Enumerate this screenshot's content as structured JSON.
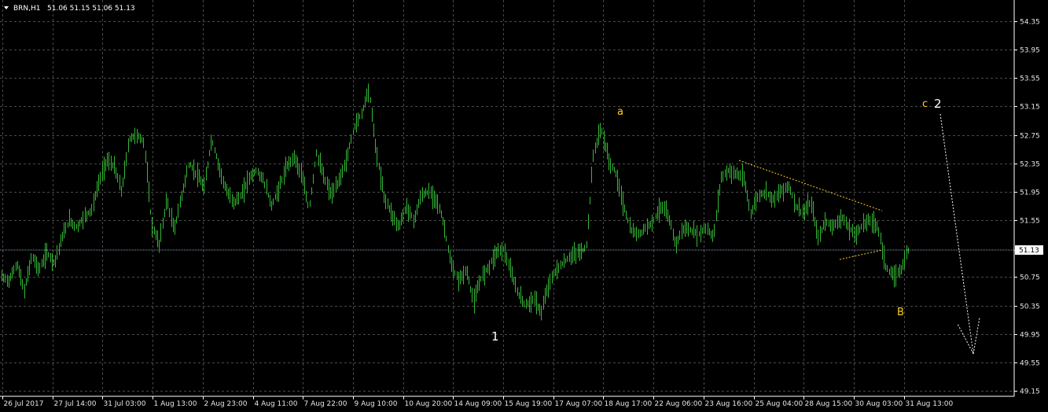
{
  "header": {
    "symbol": "BRN,H1",
    "ohlc": "51.06 51.15 51.06 51.13"
  },
  "colors": {
    "background": "#000000",
    "grid": "#4a4a4a",
    "bars": "#35b835",
    "axis": "#ffffff",
    "price_line": "#8ea3c0",
    "wave_yellow": "#ffd21a",
    "wave_white": "#ffffff"
  },
  "chart_data": {
    "type": "line",
    "ylim": [
      49.15,
      54.55
    ],
    "yticks": [
      "54.35",
      "53.95",
      "53.55",
      "53.15",
      "52.75",
      "52.35",
      "51.95",
      "51.55",
      "51.13",
      "50.75",
      "50.35",
      "49.95",
      "49.55",
      "49.15"
    ],
    "xticks": [
      "26 Jul 2017",
      "27 Jul 14:00",
      "31 Jul 03:00",
      "1 Aug 13:00",
      "2 Aug 23:00",
      "4 Aug 11:00",
      "7 Aug 22:00",
      "9 Aug 10:00",
      "10 Aug 20:00",
      "14 Aug 09:00",
      "15 Aug 19:00",
      "17 Aug 07:00",
      "18 Aug 17:00",
      "22 Aug 06:00",
      "23 Aug 16:00",
      "25 Aug 04:00",
      "28 Aug 15:00",
      "30 Aug 03:00",
      "31 Aug 13:00"
    ],
    "current_price": "51.13",
    "grid": true,
    "series": [
      {
        "values": [
          50.75,
          50.7,
          50.95,
          50.55,
          51.05,
          50.85,
          51.1,
          50.95,
          51.3,
          51.55,
          51.45,
          51.6,
          51.7,
          52.1,
          52.4,
          52.3,
          51.95,
          52.7,
          52.75,
          52.65,
          51.5,
          51.2,
          51.85,
          51.4,
          51.9,
          52.35,
          52.2,
          52.0,
          52.7,
          52.3,
          51.95,
          51.8,
          51.9,
          52.15,
          52.25,
          52.1,
          51.75,
          52.0,
          52.3,
          52.45,
          52.2,
          51.7,
          52.5,
          52.15,
          51.9,
          52.1,
          52.4,
          52.85,
          53.05,
          53.4,
          52.5,
          51.9,
          51.65,
          51.45,
          51.75,
          51.55,
          51.9,
          51.95,
          51.85,
          51.5,
          50.9,
          50.7,
          50.85,
          50.4,
          50.75,
          50.9,
          51.1,
          51.15,
          50.8,
          50.5,
          50.35,
          50.45,
          50.25,
          50.65,
          50.85,
          50.95,
          51.05,
          51.1,
          51.15,
          52.5,
          52.85,
          52.4,
          52.2,
          51.75,
          51.4,
          51.35,
          51.45,
          51.55,
          51.75,
          51.6,
          51.2,
          51.45,
          51.4,
          51.35,
          51.45,
          51.3,
          52.15,
          52.25,
          52.2,
          52.15,
          51.65,
          51.9,
          51.95,
          51.85,
          51.95,
          52.05,
          51.75,
          51.65,
          51.8,
          51.3,
          51.55,
          51.45,
          51.6,
          51.45,
          51.35,
          51.5,
          51.55,
          51.45,
          50.9,
          50.75,
          50.85,
          51.13
        ]
      }
    ],
    "annotations": [
      {
        "text": "a",
        "color": "#ffd21a"
      },
      {
        "text": "c",
        "color": "#ffd21a"
      },
      {
        "text": "B",
        "color": "#ffd21a"
      },
      {
        "text": "1",
        "color": "#ffffff"
      },
      {
        "text": "2",
        "color": "#ffffff"
      }
    ]
  }
}
